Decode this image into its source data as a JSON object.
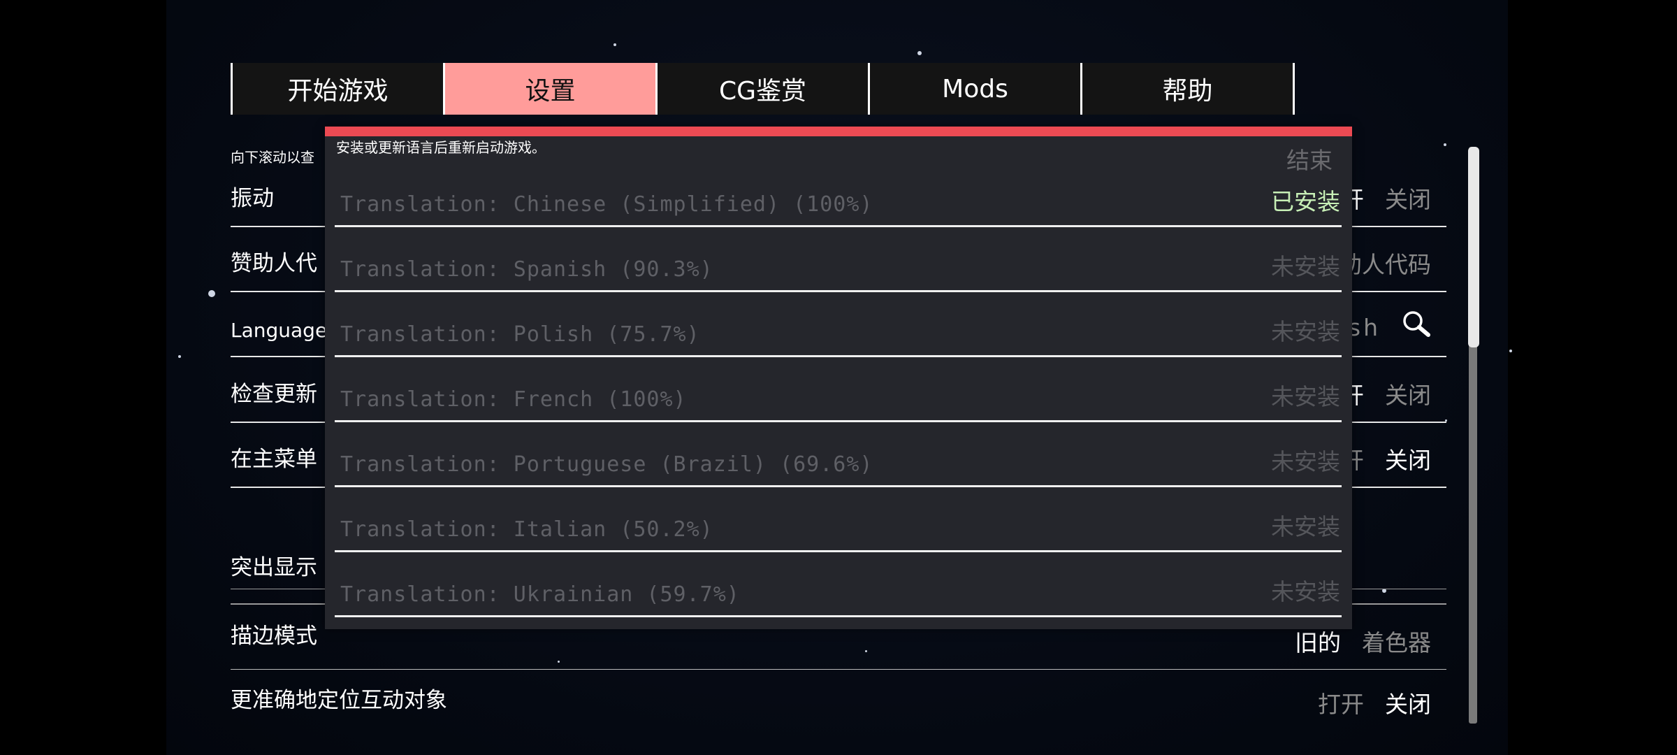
{
  "tabs": [
    {
      "label": "开始游戏"
    },
    {
      "label": "设置",
      "active": true
    },
    {
      "label": "CG鉴赏"
    },
    {
      "label": "Mods"
    },
    {
      "label": "帮助"
    }
  ],
  "settings": {
    "hint": "向下滚动以查",
    "rows": [
      {
        "label": "振动",
        "values": [
          "开",
          "关闭"
        ],
        "selected": 0
      },
      {
        "label": "赞助人代",
        "values": [
          "助人代码"
        ]
      },
      {
        "label": "Language",
        "values": [
          "ish"
        ],
        "icon": "search-icon"
      },
      {
        "label": "检查更新",
        "values": [
          "开",
          "关闭"
        ],
        "selected": 0
      },
      {
        "label": "在主菜单",
        "values": [
          "开",
          "关闭"
        ],
        "selected": 1
      },
      {
        "label": "突出显示"
      },
      {
        "label": "描边模式",
        "values": [
          "旧的",
          "着色器"
        ],
        "selected": 0
      },
      {
        "label": "更准确地定位互动对象",
        "values": [
          "打开",
          "关闭"
        ],
        "selected": 1
      }
    ]
  },
  "modal": {
    "hint": "安装或更新语言后重新启动游戏。",
    "close_label": "结束",
    "accent": "#ec4a53",
    "languages": [
      {
        "name": "Translation: Chinese (Simplified) (100%)",
        "status": "已安装",
        "installed": true
      },
      {
        "name": "Translation: Spanish (90.3%)",
        "status": "未安装"
      },
      {
        "name": "Translation: Polish (75.7%)",
        "status": "未安装"
      },
      {
        "name": "Translation: French (100%)",
        "status": "未安装"
      },
      {
        "name": "Translation: Portuguese (Brazil) (69.6%)",
        "status": "未安装"
      },
      {
        "name": "Translation: Italian (50.2%)",
        "status": "未安装"
      },
      {
        "name": "Translation: Ukrainian (59.7%)",
        "status": "未安装"
      }
    ]
  },
  "scrollbar": {
    "position": 0
  }
}
